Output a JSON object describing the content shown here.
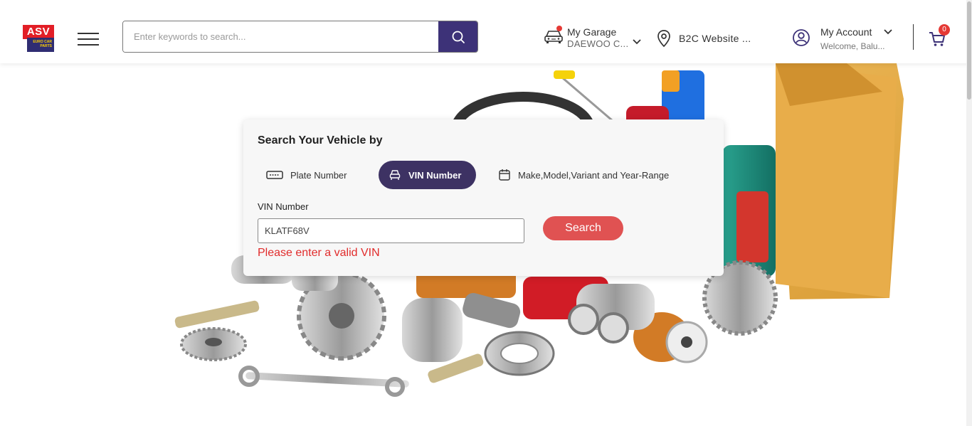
{
  "logo": {
    "brand": "ASV",
    "tagline": "EURO CAR PARTS"
  },
  "search": {
    "placeholder": "Enter keywords to search..."
  },
  "garage": {
    "title": "My Garage",
    "vehicle": "DAEWOO C..."
  },
  "location": {
    "label": "B2C Website ..."
  },
  "account": {
    "title": "My Account",
    "greeting": "Welcome, Balu..."
  },
  "cart": {
    "count": "0"
  },
  "vehicle_search": {
    "title": "Search Your Vehicle by",
    "tabs": [
      {
        "label": "Plate Number",
        "active": false
      },
      {
        "label": "VIN Number",
        "active": true
      },
      {
        "label": "Make,Model,Variant and Year-Range",
        "active": false
      }
    ],
    "vin_label": "VIN Number",
    "vin_value": "KLATF68V",
    "search_label": "Search",
    "error": "Please enter a valid VIN"
  },
  "colors": {
    "brand_purple": "#3d3278",
    "accent_red": "#e05252",
    "error_red": "#e12b2b"
  }
}
